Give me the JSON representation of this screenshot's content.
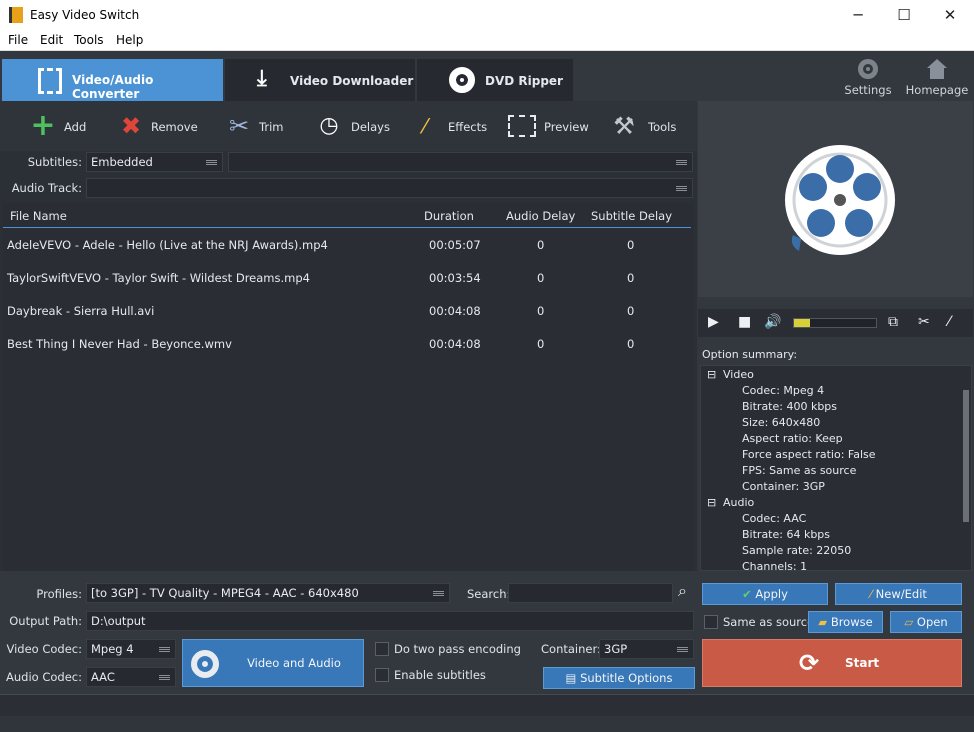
{
  "window": {
    "title": "Easy Video Switch",
    "minimize": "─",
    "maximize": "☐",
    "close": "✕"
  },
  "menu": [
    "File",
    "Edit",
    "Tools",
    "Help"
  ],
  "tabs": [
    {
      "label": "Video/Audio Converter"
    },
    {
      "label": "Video Downloader"
    },
    {
      "label": "DVD Ripper"
    }
  ],
  "topright": {
    "settings": "Settings",
    "homepage": "Homepage"
  },
  "toolbar": {
    "add": "Add",
    "remove": "Remove",
    "trim": "Trim",
    "delays": "Delays",
    "effects": "Effects",
    "preview": "Preview",
    "tools": "Tools"
  },
  "subtitles": {
    "label": "Subtitles:",
    "value": "Embedded",
    "value2": ""
  },
  "audio_track": {
    "label": "Audio Track:",
    "value": ""
  },
  "table": {
    "headers": {
      "file": "File Name",
      "duration": "Duration",
      "audio_delay": "Audio Delay",
      "subtitle_delay": "Subtitle Delay"
    },
    "rows": [
      {
        "file": "AdeleVEVO - Adele - Hello (Live at the NRJ Awards).mp4",
        "duration": "00:05:07",
        "audio_delay": "0",
        "subtitle_delay": "0"
      },
      {
        "file": "TaylorSwiftVEVO - Taylor Swift - Wildest Dreams.mp4",
        "duration": "00:03:54",
        "audio_delay": "0",
        "subtitle_delay": "0"
      },
      {
        "file": "Daybreak - Sierra Hull.avi",
        "duration": "00:04:08",
        "audio_delay": "0",
        "subtitle_delay": "0"
      },
      {
        "file": "Best Thing I Never Had - Beyonce.wmv",
        "duration": "00:04:08",
        "audio_delay": "0",
        "subtitle_delay": "0"
      }
    ]
  },
  "player": {
    "volume_level": 0.2
  },
  "summary": {
    "label": "Option summary:",
    "video_header": "Video",
    "video_items": [
      "Codec: Mpeg 4",
      "Bitrate: 400 kbps",
      "Size: 640x480",
      "Aspect ratio: Keep",
      "Force aspect ratio: False",
      "FPS: Same as source",
      "Container: 3GP"
    ],
    "audio_header": "Audio",
    "audio_items": [
      "Codec: AAC",
      "Bitrate: 64 kbps",
      "Sample rate: 22050",
      "Channels: 1"
    ]
  },
  "bottom": {
    "profiles_label": "Profiles:",
    "profiles_value": "[to 3GP] - TV Quality - MPEG4 - AAC - 640x480",
    "search_label": "Search:",
    "search_value": "",
    "apply": "Apply",
    "new_edit": "New/Edit",
    "output_label": "Output Path:",
    "output_value": "D:\\output",
    "same_as_source": "Same as source",
    "browse": "Browse",
    "open": "Open",
    "video_codec_label": "Video Codec:",
    "video_codec_value": "Mpeg 4",
    "audio_codec_label": "Audio Codec:",
    "audio_codec_value": "AAC",
    "va_options": "Video and Audio Options",
    "two_pass": "Do two pass encoding",
    "enable_subs": "Enable subtitles",
    "container_label": "Container:",
    "container_value": "3GP",
    "subtitle_options": "Subtitle Options",
    "start": "Start"
  }
}
